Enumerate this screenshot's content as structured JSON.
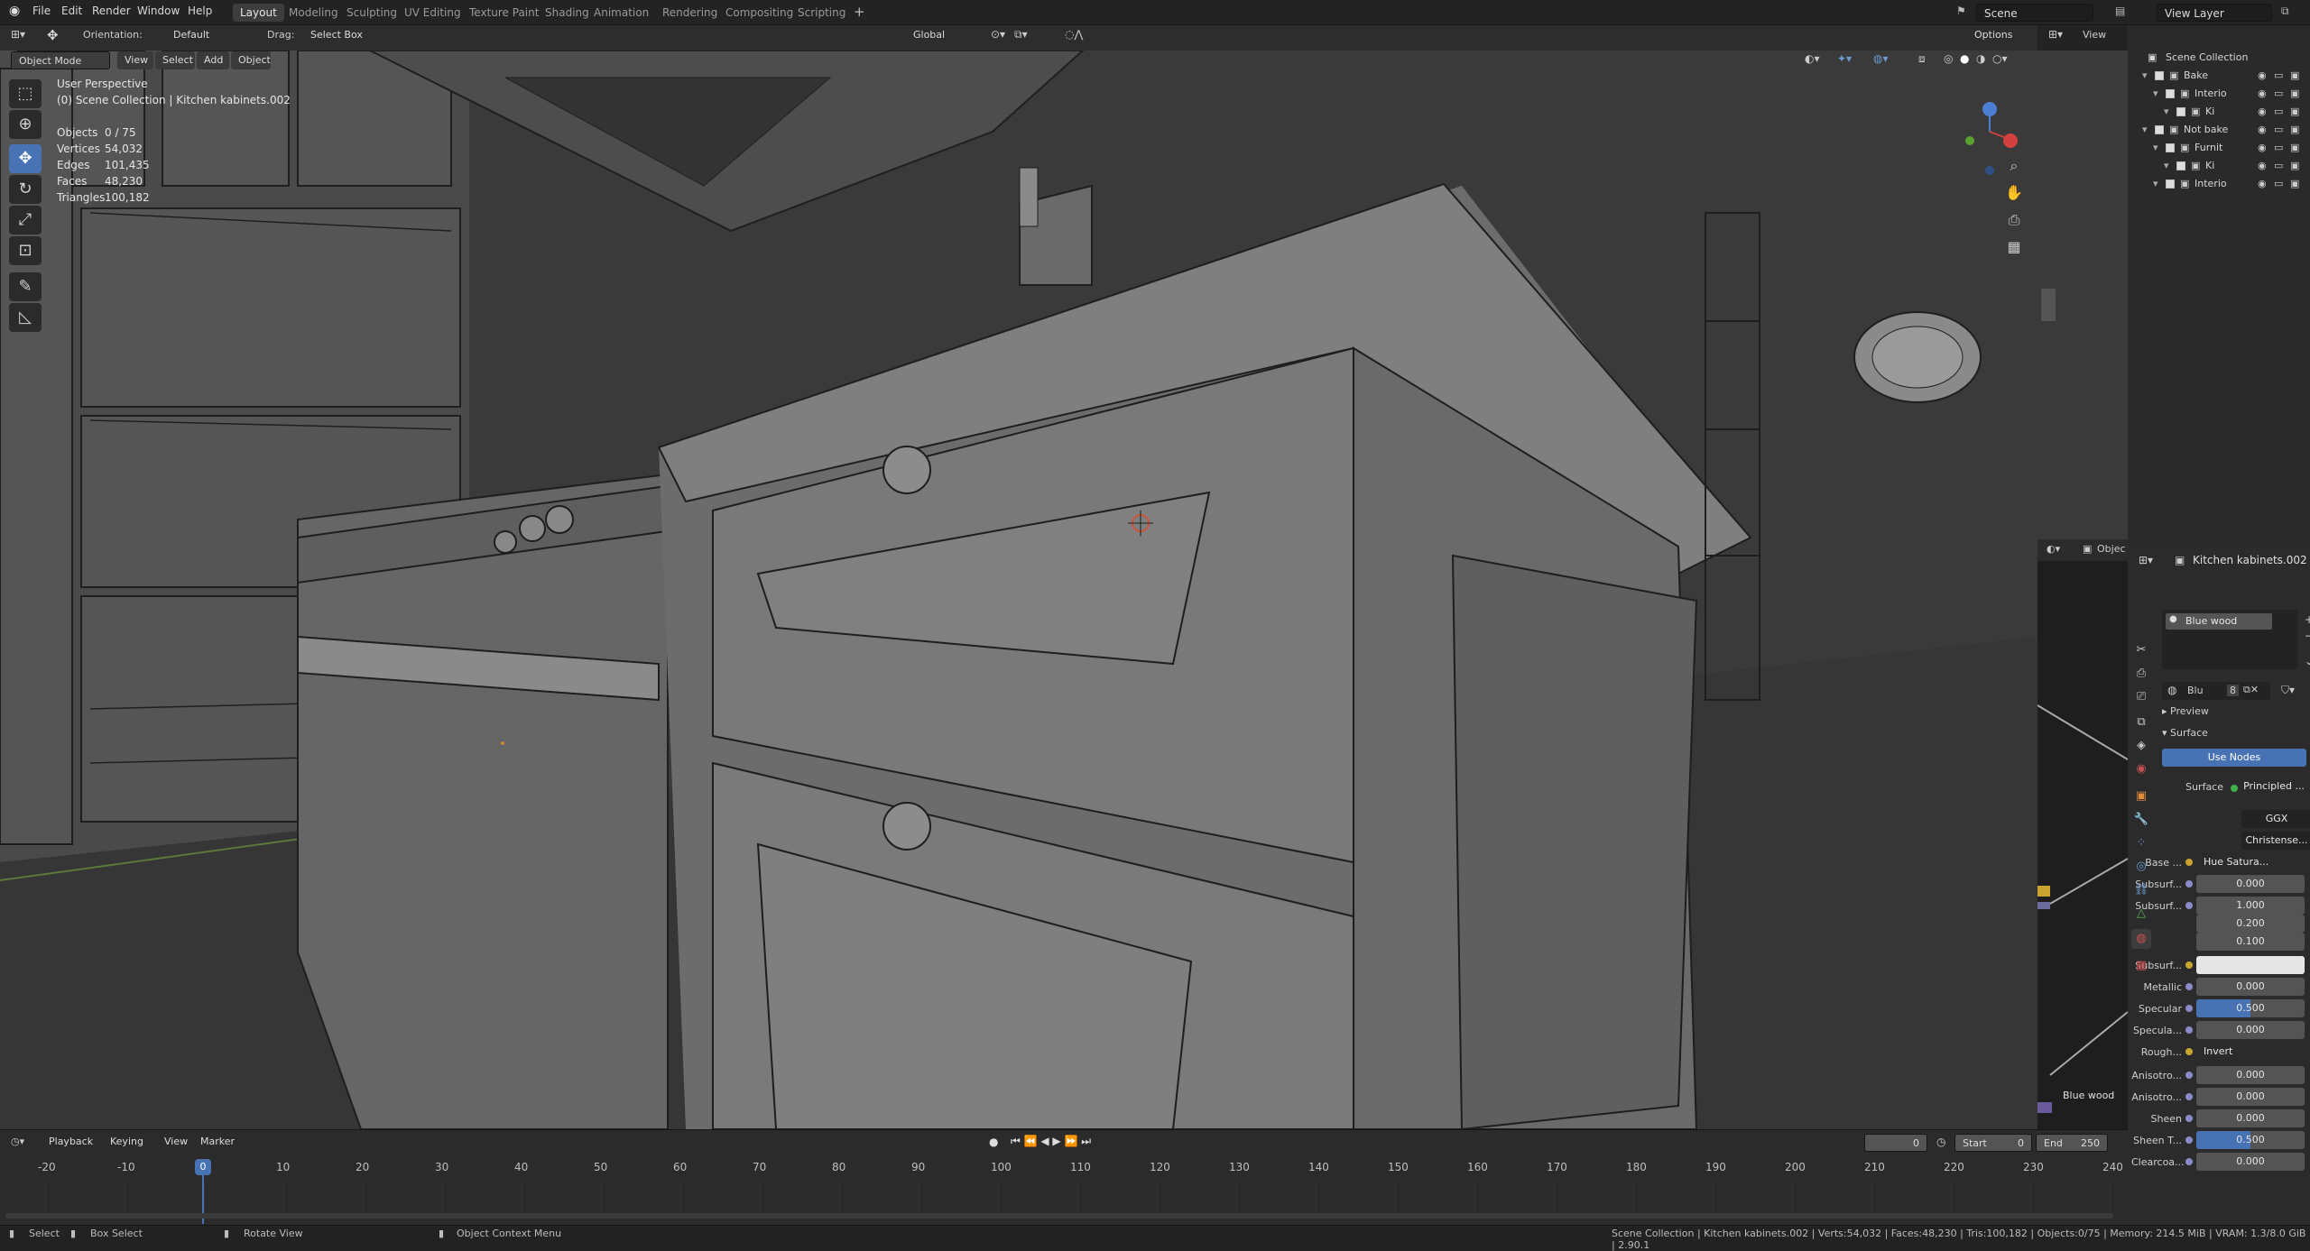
{
  "menu": {
    "file": "File",
    "edit": "Edit",
    "render": "Render",
    "window": "Window",
    "help": "Help"
  },
  "workspaces": [
    "Layout",
    "Modeling",
    "Sculpting",
    "UV Editing",
    "Texture Paint",
    "Shading",
    "Animation",
    "Rendering",
    "Compositing",
    "Scripting"
  ],
  "scene": {
    "name": "Scene",
    "view_layer": "View Layer"
  },
  "header": {
    "orientation_label": "Orientation:",
    "orientation_value": "Default",
    "drag_label": "Drag:",
    "drag_value": "Select Box",
    "transform_orientation": "Global",
    "options": "Options",
    "view": "View"
  },
  "viewport_header": {
    "mode": "Object Mode",
    "view": "View",
    "select": "Select",
    "add": "Add",
    "object": "Object"
  },
  "overlay": {
    "perspective": "User Perspective",
    "collection": "(0) Scene Collection | Kitchen kabinets.002",
    "stats": [
      {
        "label": "Objects",
        "value": "0 / 75"
      },
      {
        "label": "Vertices",
        "value": "54,032"
      },
      {
        "label": "Edges",
        "value": "101,435"
      },
      {
        "label": "Faces",
        "value": "48,230"
      },
      {
        "label": "Triangles",
        "value": "100,182"
      }
    ]
  },
  "outliner": {
    "title": "Scene Collection",
    "rows": [
      {
        "label": "Bake",
        "indent": 1
      },
      {
        "label": "Interio",
        "indent": 2
      },
      {
        "label": "Ki",
        "indent": 3
      },
      {
        "label": "Not bake",
        "indent": 1
      },
      {
        "label": "Furnit",
        "indent": 2
      },
      {
        "label": "Ki",
        "indent": 3
      },
      {
        "label": "Interio",
        "indent": 2
      }
    ]
  },
  "node_panel": {
    "object_label": "Objec",
    "material_label": "Blue wood"
  },
  "properties": {
    "object": "Kitchen kabinets.002",
    "material_slot": "Blue wood",
    "material_short": "Blu",
    "users": "8",
    "preview": "Preview",
    "surface_section": "Surface",
    "use_nodes": "Use Nodes",
    "surface_label": "Surface",
    "surface_value": "Principled ...",
    "distribution": "GGX",
    "subsurface_method": "Christense...",
    "rows": [
      {
        "label": "Base ...",
        "value": "Hue Satura...",
        "type": "link"
      },
      {
        "label": "Subsurf...",
        "value": "0.000"
      },
      {
        "label": "Subsurf...",
        "value": "1.000"
      },
      {
        "label": "",
        "value": "0.200"
      },
      {
        "label": "",
        "value": "0.100"
      },
      {
        "label": "Subsurf...",
        "value": "",
        "type": "color"
      },
      {
        "label": "Metallic",
        "value": "0.000"
      },
      {
        "label": "Specular",
        "value": "0.500",
        "type": "slider"
      },
      {
        "label": "Specula...",
        "value": "0.000"
      },
      {
        "label": "Rough...",
        "value": "Invert",
        "type": "link"
      },
      {
        "label": "Anisotro...",
        "value": "0.000"
      },
      {
        "label": "Anisotro...",
        "value": "0.000"
      },
      {
        "label": "Sheen",
        "value": "0.000"
      },
      {
        "label": "Sheen T...",
        "value": "0.500",
        "type": "slider"
      },
      {
        "label": "Clearcoa...",
        "value": "0.000"
      }
    ]
  },
  "timeline": {
    "playback": "Playback",
    "keying": "Keying",
    "view": "View",
    "marker": "Marker",
    "current": "0",
    "start_label": "Start",
    "start": "0",
    "end_label": "End",
    "end": "250",
    "playhead": "0",
    "ticks": [
      "-20",
      "-10",
      "0",
      "10",
      "20",
      "30",
      "40",
      "50",
      "60",
      "70",
      "80",
      "90",
      "100",
      "110",
      "120",
      "130",
      "140",
      "150",
      "160",
      "170",
      "180",
      "190",
      "200",
      "210",
      "220",
      "230",
      "240"
    ]
  },
  "status": {
    "select": "Select",
    "box_select": "Box Select",
    "rotate": "Rotate View",
    "context": "Object Context Menu",
    "info": "Scene Collection | Kitchen kabinets.002 | Verts:54,032 | Faces:48,230 | Tris:100,182 | Objects:0/75 | Memory: 214.5 MiB | VRAM: 1.3/8.0 GiB | 2.90.1"
  },
  "colors": {
    "accent": "#4772b3",
    "bg": "#232323",
    "viewport": "#3b3b3b",
    "cabinet": "#7a7a7a"
  }
}
